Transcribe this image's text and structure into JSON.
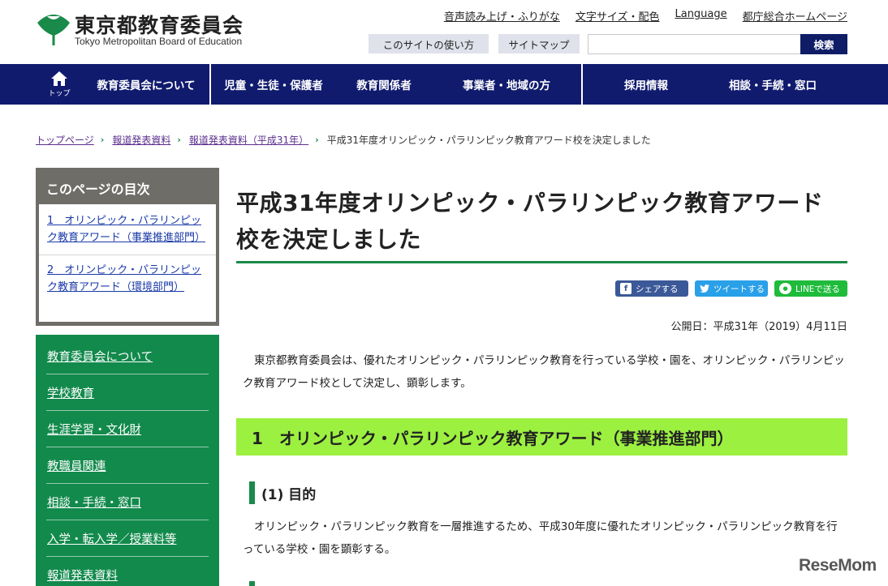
{
  "header": {
    "logo_jp": "東京都教育委員会",
    "logo_en": "Tokyo Metropolitan Board of Education",
    "util_links": [
      "音声読み上げ・ふりがな",
      "文字サイズ・配色",
      "Language",
      "都庁総合ホームページ"
    ],
    "guide_button": "このサイトの使い方",
    "sitemap_button": "サイトマップ",
    "search_placeholder": "",
    "search_button": "検索"
  },
  "gnav": {
    "home_label": "トップ",
    "items": [
      "教育委員会について",
      "児童・生徒・保護者",
      "教育関係者",
      "事業者・地域の方",
      "採用情報",
      "相談・手続・窓口"
    ]
  },
  "breadcrumb": {
    "links": [
      "トップページ",
      "報道発表資料",
      "報道発表資料（平成31年）"
    ],
    "current": "平成31年度オリンピック・パラリンピック教育アワード校を決定しました"
  },
  "toc": {
    "title": "このページの目次",
    "items": [
      "1　オリンピック・パラリンピック教育アワード（事業推進部門）",
      "2　オリンピック・パラリンピック教育アワード（環境部門）"
    ]
  },
  "sidenav": {
    "items": [
      "教育委員会について",
      "学校教育",
      "生涯学習・文化財",
      "教職員関連",
      "相談・手続・窓口",
      "入学・転入学／授業料等",
      "報道発表資料"
    ]
  },
  "main": {
    "title": "平成31年度オリンピック・パラリンピック教育アワード校を決定しました",
    "share": {
      "facebook": "シェアする",
      "twitter": "ツイートする",
      "line": "LINEで送る"
    },
    "pubdate": "公開日：平成31年（2019）4月11日",
    "intro": "東京都教育委員会は、優れたオリンピック・パラリンピック教育を行っている学校・園を、オリンピック・パラリンピック教育アワード校として決定し、顕彰します。",
    "section1_heading": "1　オリンピック・パラリンピック教育アワード（事業推進部門）",
    "sub1_heading": "(1) 目的",
    "sub1_text": "オリンピック・パラリンピック教育を一層推進するため、平成30年度に優れたオリンピック・パラリンピック教育を行っている学校・園を顕彰する。"
  },
  "watermark": "ReseMom",
  "colors": {
    "navy": "#101b6e",
    "green": "#1a8a4a",
    "lime": "#9cf040",
    "toc_gray": "#6f6d68"
  },
  "icons": [
    "logo-ginkgo-icon",
    "home-icon",
    "chevron-right-icon",
    "facebook-icon",
    "twitter-icon",
    "line-icon"
  ]
}
